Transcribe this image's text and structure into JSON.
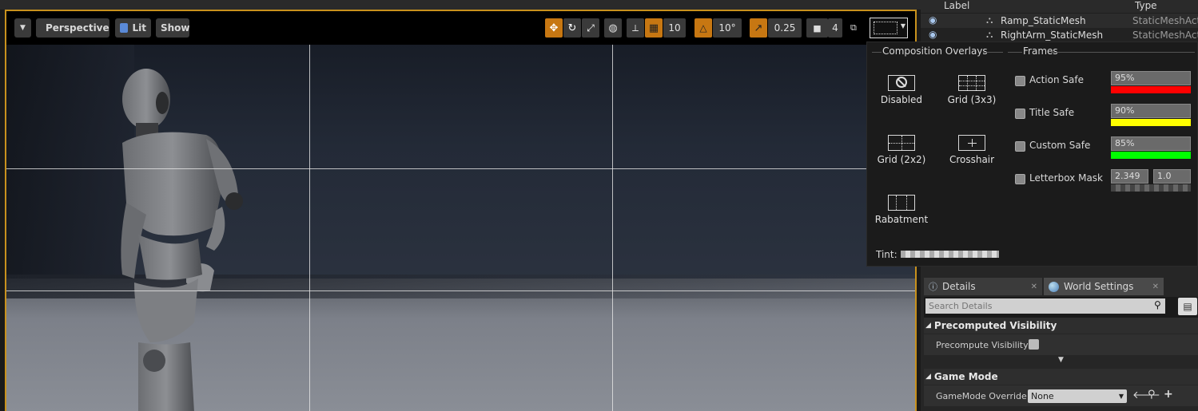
{
  "toolbar": {
    "perspective_label": "Perspective",
    "lit_label": "Lit",
    "show_label": "Show",
    "grid_snap_value": "10",
    "rotation_snap_value": "10°",
    "scale_snap_value": "0.25",
    "camera_speed_value": "4"
  },
  "overlay_panel": {
    "composition_title": "Composition Overlays",
    "frames_title": "Frames",
    "overlays": [
      {
        "label": "Disabled"
      },
      {
        "label": "Grid (3x3)"
      },
      {
        "label": "Grid (2x2)"
      },
      {
        "label": "Crosshair"
      },
      {
        "label": "Rabatment"
      }
    ],
    "frames": [
      {
        "label": "Action Safe",
        "value": "95%",
        "color": "#ff0000"
      },
      {
        "label": "Title Safe",
        "value": "90%",
        "color": "#ffff00"
      },
      {
        "label": "Custom Safe",
        "value": "85%",
        "color": "#00ff00"
      },
      {
        "label": "Letterbox Mask",
        "value": "2.349",
        "value2": "1.0"
      }
    ],
    "tint_label": "Tint:"
  },
  "outliner": {
    "col_label": "Label",
    "col_type": "Type",
    "rows": [
      {
        "name": "Ramp_StaticMesh",
        "type": "StaticMeshActo"
      },
      {
        "name": "RightArm_StaticMesh",
        "type": "StaticMeshActo"
      }
    ]
  },
  "details": {
    "tabs": [
      {
        "label": "Details"
      },
      {
        "label": "World Settings"
      }
    ],
    "search_placeholder": "Search Details",
    "categories": [
      {
        "title": "Precomputed Visibility",
        "prop_label": "Precompute Visibility"
      },
      {
        "title": "Game Mode",
        "prop_label": "GameMode Override",
        "prop_value": "None"
      }
    ]
  },
  "colors": {
    "accent_orange": "#c77712",
    "viewport_border": "#c8911d"
  }
}
